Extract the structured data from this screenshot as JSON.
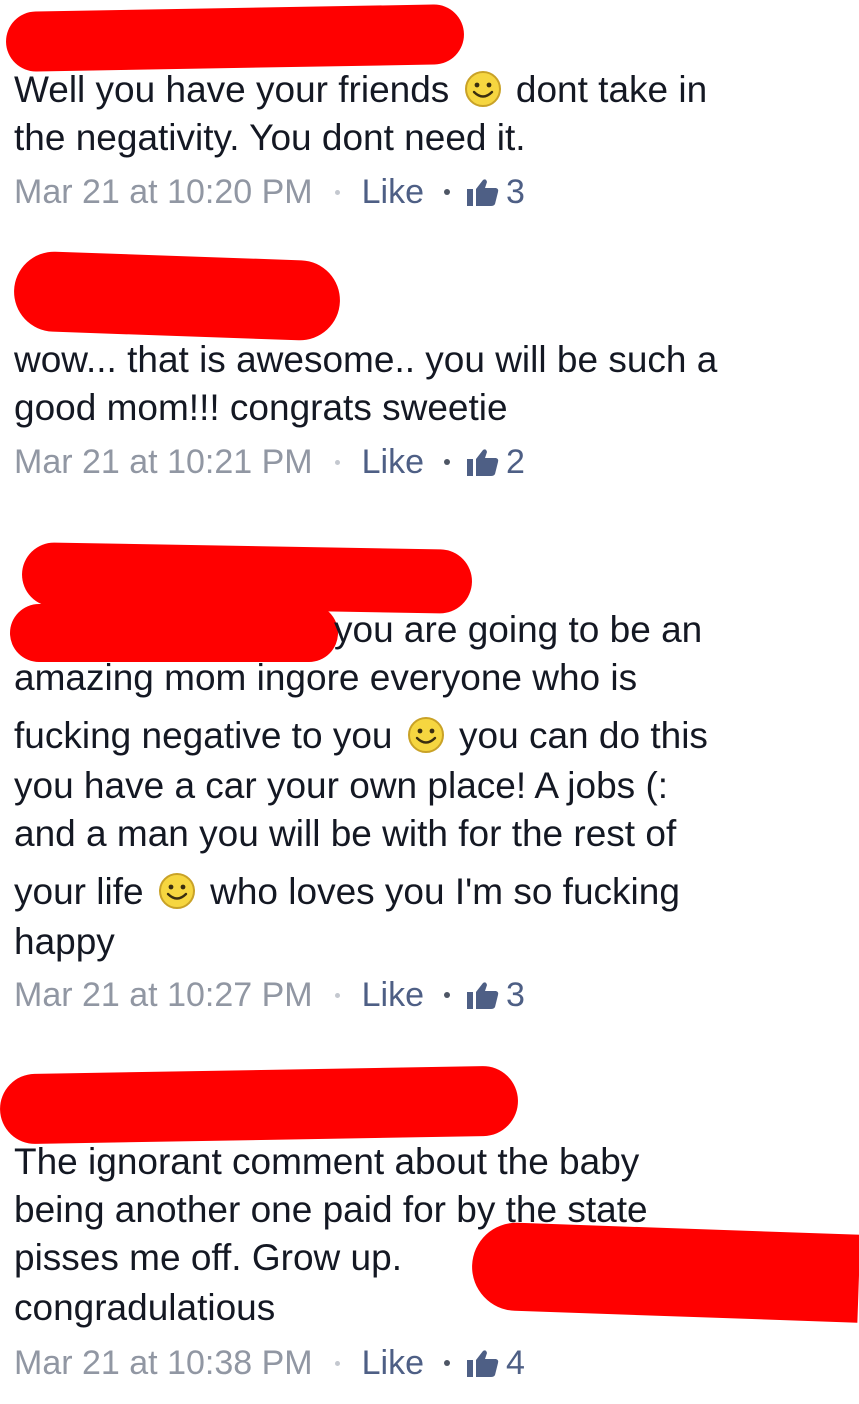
{
  "comments": [
    {
      "lines": [
        {
          "pre": "Well you have your friends",
          "post": "dont take in"
        },
        {
          "text": "the negativity. You dont need it."
        }
      ],
      "timestamp": "Mar 21 at 10:20 PM",
      "like_label": "Like",
      "like_count": "3"
    },
    {
      "lines": [
        {
          "text": "wow... that is awesome.. you will be such a"
        },
        {
          "text": "good mom!!!  congrats sweetie"
        }
      ],
      "timestamp": "Mar 21 at 10:21 PM",
      "like_label": "Like",
      "like_count": "2"
    },
    {
      "lines": [
        {
          "text": "you are going to be an"
        },
        {
          "text": "amazing mom ingore everyone who is"
        },
        {
          "pre": "fucking negative to you",
          "post": "you can do this"
        },
        {
          "text": "you have a car your own place! A jobs (:"
        },
        {
          "text": "and a man you will be with for the rest of"
        },
        {
          "pre": "your life",
          "post": "who loves you I'm so fucking"
        },
        {
          "text": "happy"
        }
      ],
      "timestamp": "Mar 21 at 10:27 PM",
      "like_label": "Like",
      "like_count": "3"
    },
    {
      "lines": [
        {
          "text": "The ignorant comment about the baby"
        },
        {
          "text": "being another one paid for by the state"
        },
        {
          "text": "pisses me off. Grow up."
        },
        {
          "text": "congradulatious"
        }
      ],
      "timestamp": "Mar 21 at 10:38 PM",
      "like_label": "Like",
      "like_count": "4"
    }
  ],
  "icons": {
    "smiley": "smiley-emoticon-icon",
    "thumb": "thumbs-up-icon"
  },
  "colors": {
    "text": "#141823",
    "meta_gray": "#9197a3",
    "link_blue": "#4e5f85",
    "redaction": "#ff0000",
    "smiley_yellow": "#f6d640"
  }
}
